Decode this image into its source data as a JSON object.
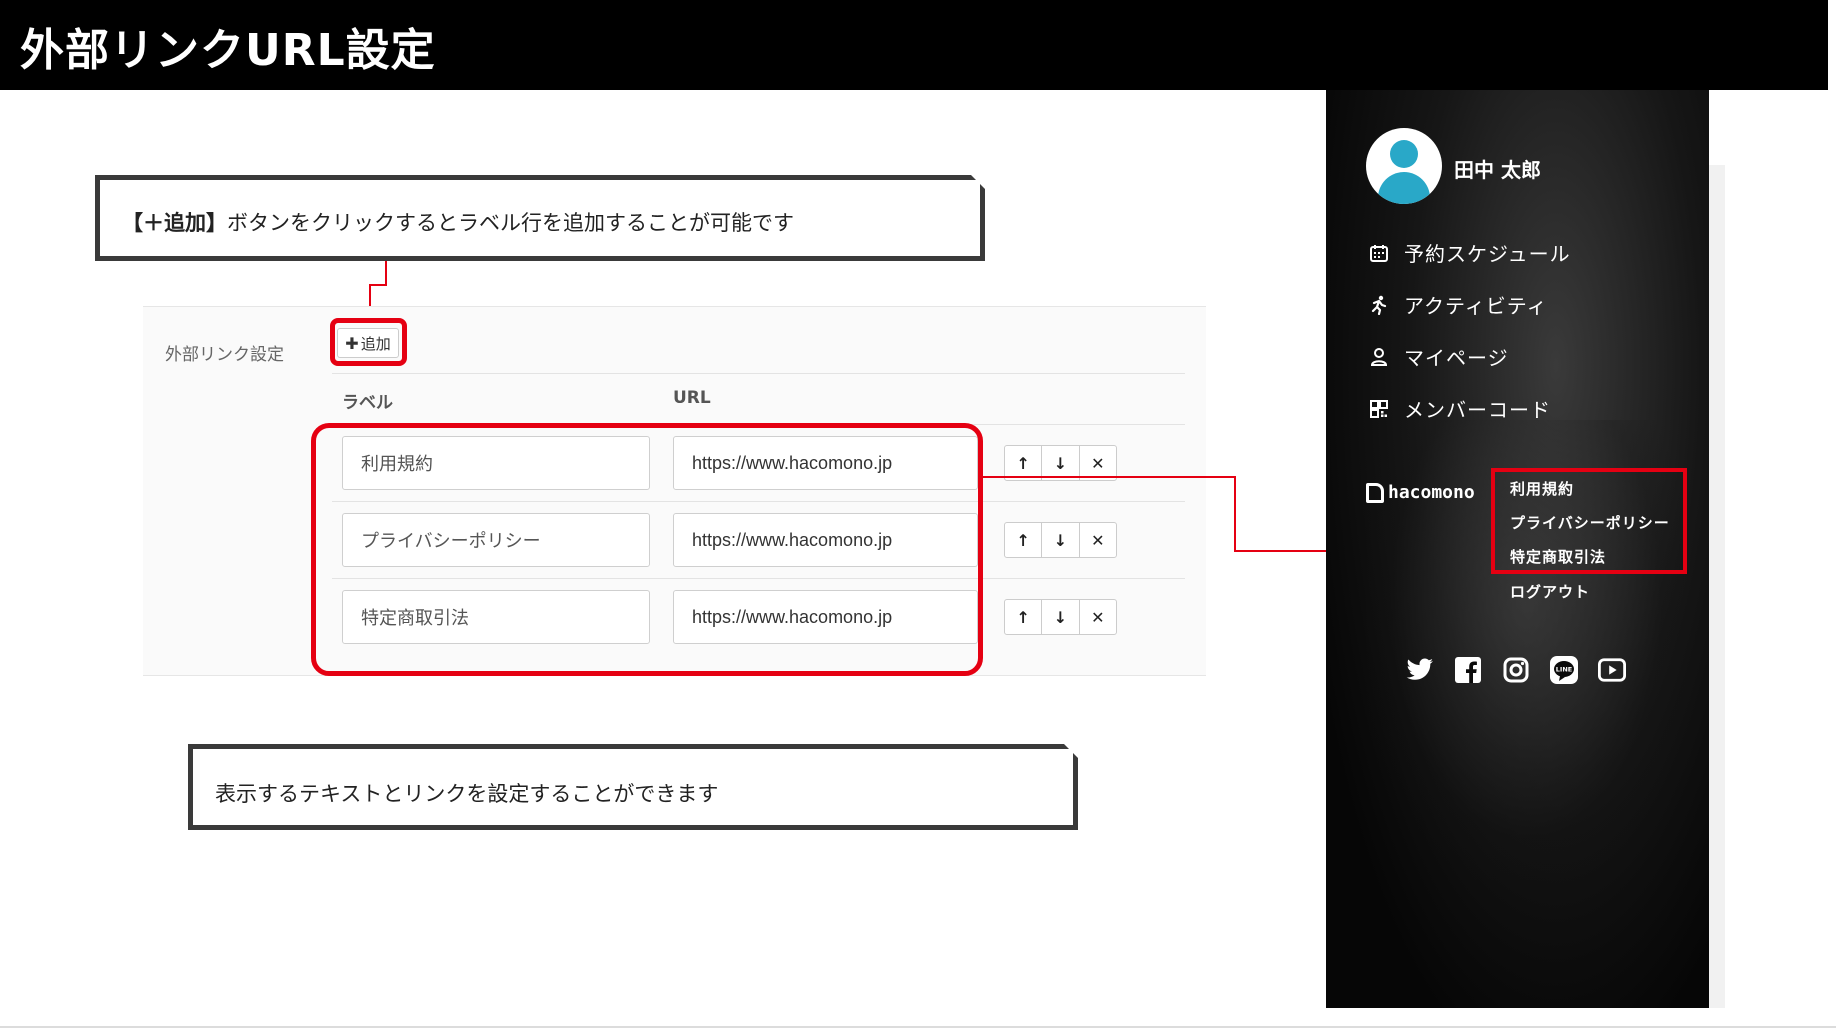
{
  "header": {
    "title": "外部リンクURL設定"
  },
  "callouts": {
    "top": {
      "bold": "【＋追加】",
      "text": "ボタンをクリックするとラベル行を追加することが可能です"
    },
    "bottom": {
      "text": "表示するテキストとリンクを設定することができます"
    }
  },
  "settings": {
    "label": "外部リンク設定",
    "add_button": "追加",
    "add_icon": "plus-icon",
    "columns": {
      "label": "ラベル",
      "url": "URL"
    },
    "rows": [
      {
        "label": "利用規約",
        "url": "https://www.hacomono.jp"
      },
      {
        "label": "プライバシーポリシー",
        "url": "https://www.hacomono.jp"
      },
      {
        "label": "特定商取引法",
        "url": "https://www.hacomono.jp"
      }
    ],
    "row_controls": {
      "up": "↑",
      "down": "↓",
      "delete": "✕"
    }
  },
  "sidebar": {
    "user_name": "田中 太郎",
    "nav": [
      {
        "label": "予約スケジュール",
        "icon": "calendar-icon"
      },
      {
        "label": "アクティビティ",
        "icon": "running-icon"
      },
      {
        "label": "マイページ",
        "icon": "person-icon"
      },
      {
        "label": "メンバーコード",
        "icon": "qr-code-icon"
      }
    ],
    "logo_text": "hacomono",
    "links": [
      "利用規約",
      "プライバシーポリシー",
      "特定商取引法"
    ],
    "logout": "ログアウト",
    "social": [
      "twitter-icon",
      "facebook-icon",
      "instagram-icon",
      "line-icon",
      "youtube-icon"
    ]
  },
  "colors": {
    "highlight": "#e50012",
    "header_bg": "#000000",
    "avatar": "#29a8c8"
  }
}
